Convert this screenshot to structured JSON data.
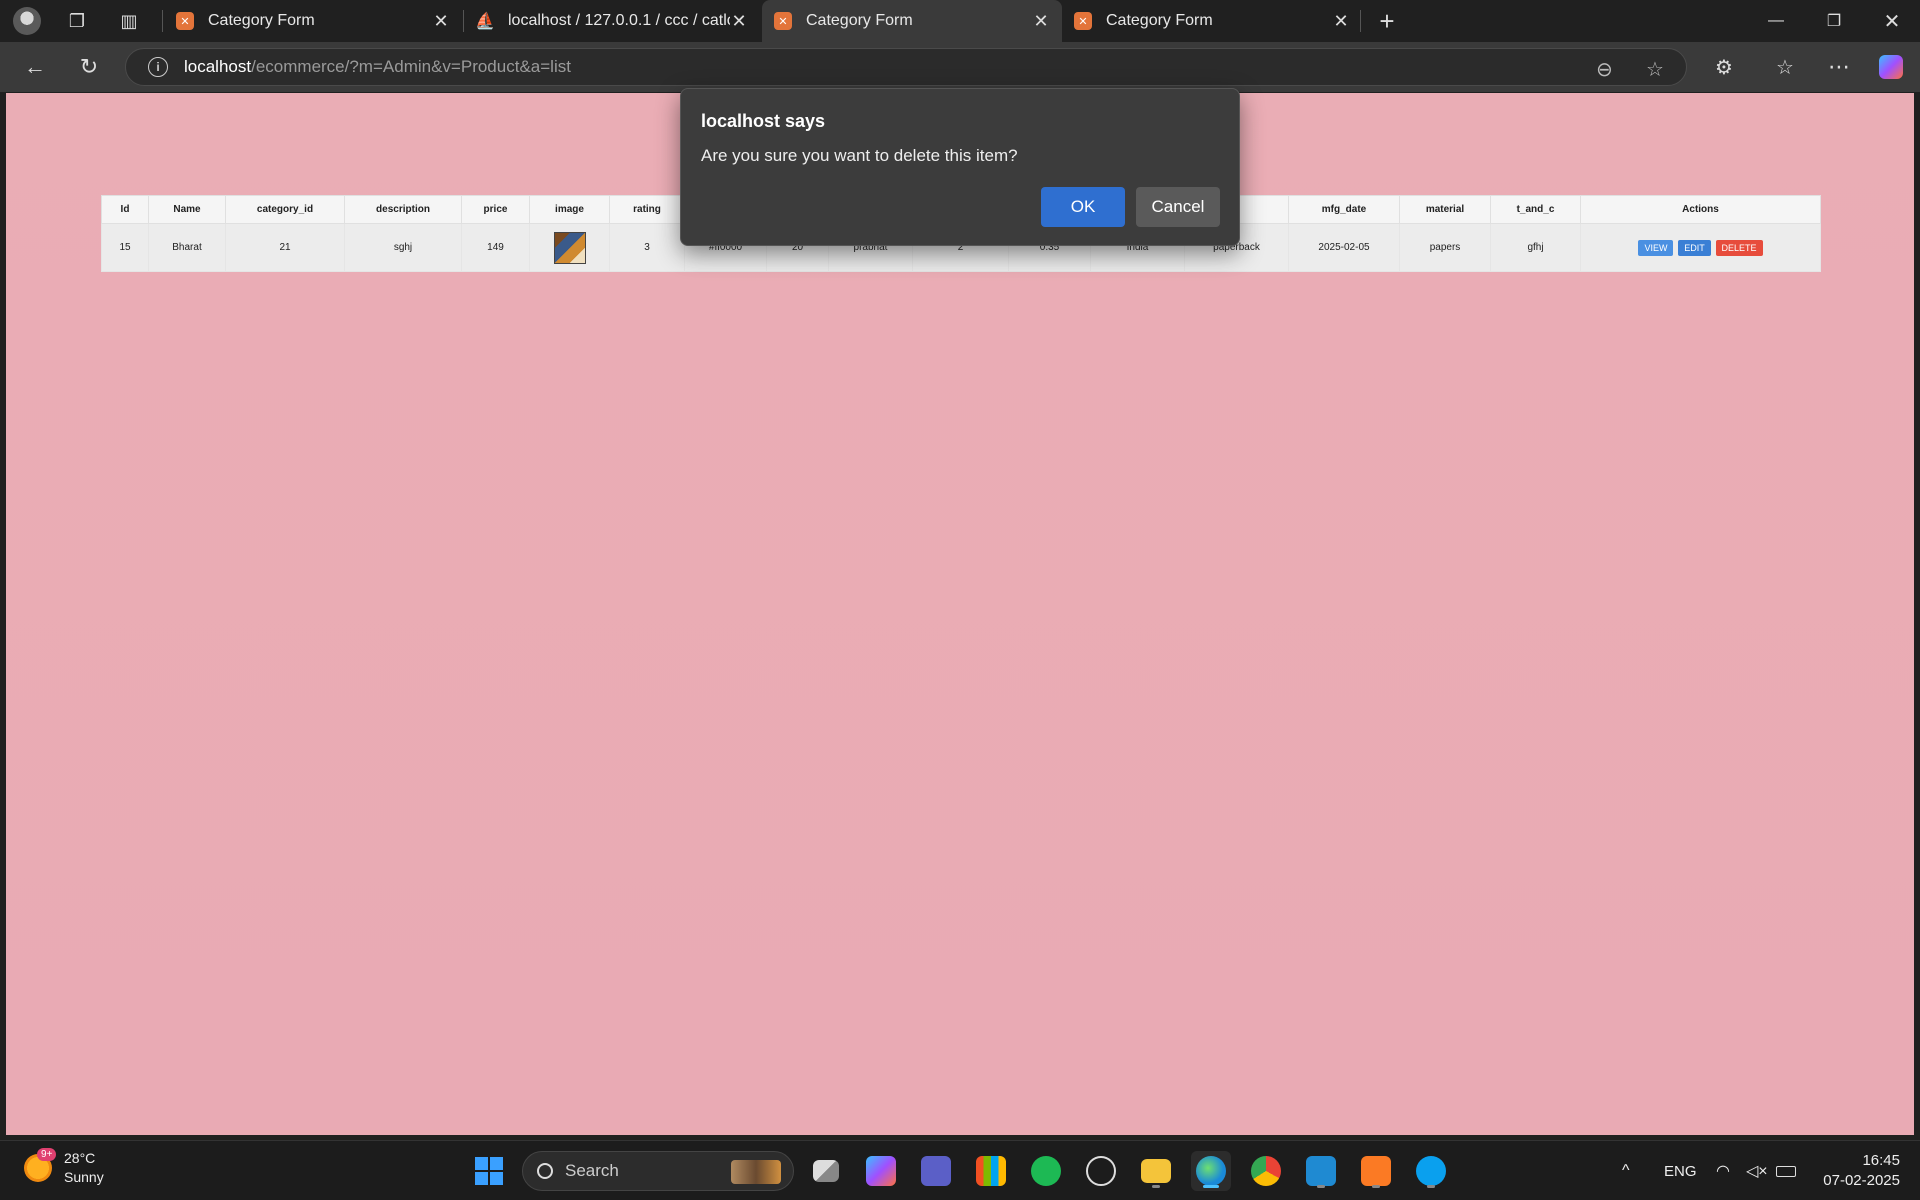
{
  "browser": {
    "tabs": [
      {
        "title": "Category Form",
        "favicon": "xampp-icon",
        "active": false
      },
      {
        "title": "localhost / 127.0.0.1 / ccc / catlog",
        "favicon": "phpmyadmin-icon",
        "active": false
      },
      {
        "title": "Category Form",
        "favicon": "xampp-icon",
        "active": true
      },
      {
        "title": "Category Form",
        "favicon": "xampp-icon",
        "active": false
      }
    ],
    "address": {
      "host": "localhost",
      "path": "/ecommerce/?m=Admin&v=Product&a=list"
    }
  },
  "table": {
    "headers": [
      "Id",
      "Name",
      "category_id",
      "description",
      "price",
      "image",
      "rating",
      "",
      "",
      "",
      "",
      "",
      "",
      "el",
      "mfg_date",
      "material",
      "t_and_c",
      "Actions"
    ],
    "row": [
      "15",
      "Bharat",
      "21",
      "sghj",
      "149",
      "",
      "3",
      "#ff0000",
      "20",
      "prabhat",
      "2",
      "0.35",
      "India",
      "paperback",
      "2025-02-05",
      "papers",
      "gfhj",
      ""
    ],
    "actions": {
      "view": "VIEW",
      "edit": "EDIT",
      "delete": "DELETE"
    }
  },
  "dialog": {
    "title": "localhost says",
    "message": "Are you sure you want to delete this item?",
    "ok": "OK",
    "cancel": "Cancel"
  },
  "taskbar": {
    "weather": {
      "temp": "28°C",
      "condition": "Sunny",
      "badge": "9+"
    },
    "search_placeholder": "Search",
    "language": "ENG",
    "time": "16:45",
    "date": "07-02-2025"
  },
  "colors": {
    "page_bg": "#eaadb5",
    "ok_button": "#2f6fd0",
    "delete_button": "#e74c3c",
    "view_button": "#4a90e2"
  }
}
